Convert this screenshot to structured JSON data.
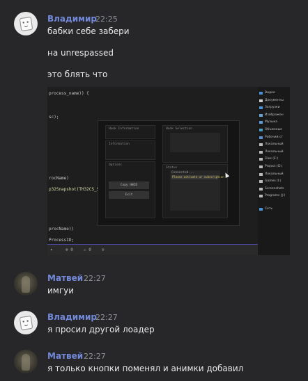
{
  "messages": [
    {
      "author": "Владимир",
      "time": "22:25",
      "lines": [
        "бабки себе забери",
        "на unrespassed",
        "это блять что"
      ]
    },
    {
      "author": "Матвей",
      "time": "22:27",
      "lines": [
        "имгуи"
      ]
    },
    {
      "author": "Владимир",
      "time": "22:27",
      "lines": [
        "я просил другой лоадер"
      ]
    },
    {
      "author": "Матвей",
      "time": "22:27",
      "lines": [
        "я только кнопки поменял и анимки добавил"
      ]
    }
  ],
  "colors": {
    "author_vladimir": "#7289da",
    "author_matvey": "#7289da",
    "background": "#27272a"
  },
  "attachment": {
    "code_lines": [
      "process_name)) {",
      "sc);",
      "rocName)",
      "p32Snapshot(TH32CS_S",
      "procName))",
      "ProcessID;"
    ],
    "bottom_items": [
      "▾",
      "⊗ 0",
      "⚠ 0",
      "⊘"
    ],
    "explorer_items": [
      "Видео",
      "Документы",
      "Загрузки",
      "Изображен",
      "Музыка",
      "Объемные",
      "Рабочий ст",
      "Локальный",
      "Локальный",
      "Files (E:)",
      "Project (G:)",
      "Локальный",
      "Games (I:)",
      "Screenshots",
      "Programs (J:)",
      "Сеть"
    ],
    "loader": {
      "hook_info": "Hook Information",
      "hook_selection": "Hook Selection",
      "information": "Information",
      "options": "Options",
      "copy_hwid": "Copy HWID",
      "exit": "Exit",
      "status_title": "Status",
      "status_connected": "Connected...",
      "status_message": "Please activate ur subscription"
    }
  }
}
